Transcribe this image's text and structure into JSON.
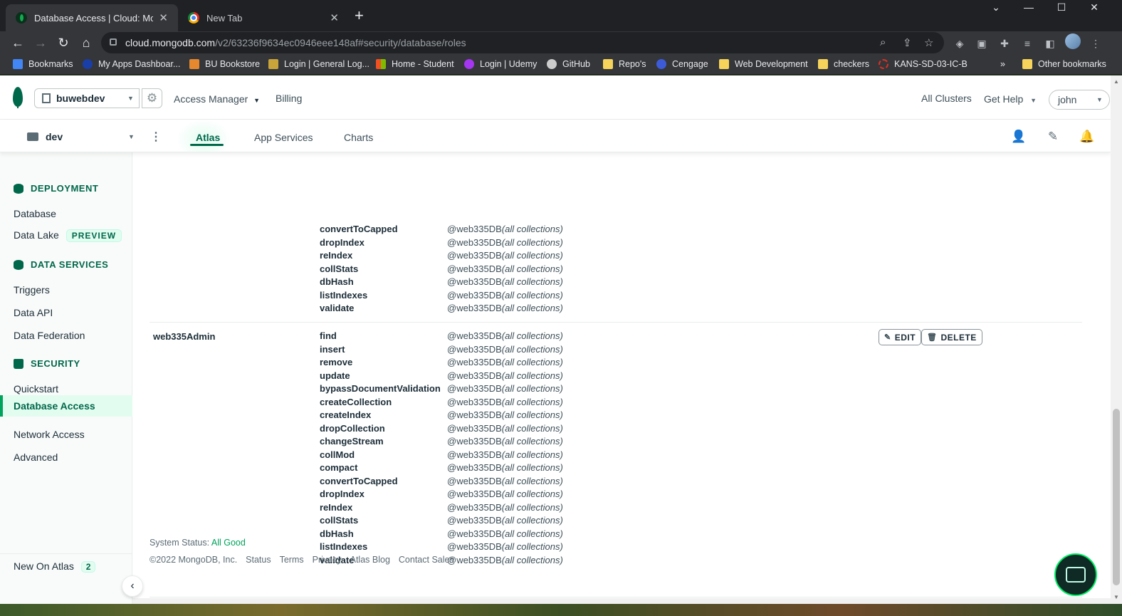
{
  "browser": {
    "tabs": [
      {
        "title": "Database Access | Cloud: Mongo",
        "active": true,
        "favicon": "mongodb-leaf-icon"
      },
      {
        "title": "New Tab",
        "active": false,
        "favicon": "chrome-icon"
      }
    ],
    "url_host": "cloud.mongodb.com",
    "url_path": "/v2/63236f9634ec0946eee148af#security/database/roles",
    "bookmarks": [
      {
        "label": "Bookmarks",
        "icon": "star-icon",
        "color": "#4285f4"
      },
      {
        "label": "My Apps Dashboar...",
        "icon": "globe-icon",
        "color": "#1a3ea8"
      },
      {
        "label": "BU Bookstore",
        "icon": "bookstore-icon",
        "color": "#e6892e"
      },
      {
        "label": "Login | General Log...",
        "icon": "eagle-icon",
        "color": "#c9a43a"
      },
      {
        "label": "Home - Student",
        "icon": "microsoft-icon",
        "color": "#f25022"
      },
      {
        "label": "Login | Udemy",
        "icon": "udemy-icon",
        "color": "#a435f0"
      },
      {
        "label": "GitHub",
        "icon": "github-icon",
        "color": "#cccccc"
      },
      {
        "label": "Repo's",
        "icon": "folder-icon",
        "color": "#f6d35b"
      },
      {
        "label": "Cengage",
        "icon": "cengage-icon",
        "color": "#3d5bd9"
      },
      {
        "label": "Web Development",
        "icon": "folder-icon",
        "color": "#f6d35b"
      },
      {
        "label": "checkers",
        "icon": "folder-icon",
        "color": "#f6d35b"
      },
      {
        "label": "KANS-SD-03-IC-B",
        "icon": "ring-icon",
        "color": "#d93025"
      }
    ],
    "overflow_label": "»",
    "other_bookmarks": "Other bookmarks"
  },
  "topnav": {
    "org": "buwebdev",
    "access_manager": "Access Manager",
    "billing": "Billing",
    "all_clusters": "All Clusters",
    "get_help": "Get Help",
    "user": "john"
  },
  "projnav": {
    "project": "dev",
    "tabs": [
      "Atlas",
      "App Services",
      "Charts"
    ],
    "active_tab": "Atlas"
  },
  "sidebar": {
    "deployment": {
      "heading": "DEPLOYMENT",
      "items": [
        "Database",
        "Data Lake"
      ],
      "data_lake_badge": "PREVIEW"
    },
    "data_services": {
      "heading": "DATA SERVICES",
      "items": [
        "Triggers",
        "Data API",
        "Data Federation"
      ]
    },
    "security": {
      "heading": "SECURITY",
      "items": [
        "Quickstart",
        "Database Access",
        "Network Access",
        "Advanced"
      ],
      "active": "Database Access"
    },
    "new_on_atlas": {
      "label": "New On Atlas",
      "count": "2"
    }
  },
  "roles": {
    "previous_tail": [
      {
        "action": "convertToCapped",
        "db": "@web335DB",
        "scope": "(all collections)"
      },
      {
        "action": "dropIndex",
        "db": "@web335DB",
        "scope": "(all collections)"
      },
      {
        "action": "reIndex",
        "db": "@web335DB",
        "scope": "(all collections)"
      },
      {
        "action": "collStats",
        "db": "@web335DB",
        "scope": "(all collections)"
      },
      {
        "action": "dbHash",
        "db": "@web335DB",
        "scope": "(all collections)"
      },
      {
        "action": "listIndexes",
        "db": "@web335DB",
        "scope": "(all collections)"
      },
      {
        "action": "validate",
        "db": "@web335DB",
        "scope": "(all collections)"
      }
    ],
    "web335Admin": {
      "name": "web335Admin",
      "edit_label": "EDIT",
      "delete_label": "DELETE",
      "actions": [
        {
          "action": "find",
          "db": "@web335DB",
          "scope": "(all collections)"
        },
        {
          "action": "insert",
          "db": "@web335DB",
          "scope": "(all collections)"
        },
        {
          "action": "remove",
          "db": "@web335DB",
          "scope": "(all collections)"
        },
        {
          "action": "update",
          "db": "@web335DB",
          "scope": "(all collections)"
        },
        {
          "action": "bypassDocumentValidation",
          "db": "@web335DB",
          "scope": "(all collections)"
        },
        {
          "action": "createCollection",
          "db": "@web335DB",
          "scope": "(all collections)"
        },
        {
          "action": "createIndex",
          "db": "@web335DB",
          "scope": "(all collections)"
        },
        {
          "action": "dropCollection",
          "db": "@web335DB",
          "scope": "(all collections)"
        },
        {
          "action": "changeStream",
          "db": "@web335DB",
          "scope": "(all collections)"
        },
        {
          "action": "collMod",
          "db": "@web335DB",
          "scope": "(all collections)"
        },
        {
          "action": "compact",
          "db": "@web335DB",
          "scope": "(all collections)"
        },
        {
          "action": "convertToCapped",
          "db": "@web335DB",
          "scope": "(all collections)"
        },
        {
          "action": "dropIndex",
          "db": "@web335DB",
          "scope": "(all collections)"
        },
        {
          "action": "reIndex",
          "db": "@web335DB",
          "scope": "(all collections)"
        },
        {
          "action": "collStats",
          "db": "@web335DB",
          "scope": "(all collections)"
        },
        {
          "action": "dbHash",
          "db": "@web335DB",
          "scope": "(all collections)"
        },
        {
          "action": "listIndexes",
          "db": "@web335DB",
          "scope": "(all collections)"
        },
        {
          "action": "validate",
          "db": "@web335DB",
          "scope": "(all collections)"
        }
      ]
    }
  },
  "footer": {
    "system_status_label": "System Status:",
    "system_status_value": "All Good",
    "copyright": "©2022 MongoDB, Inc.",
    "links": [
      "Status",
      "Terms",
      "Privacy",
      "Atlas Blog",
      "Contact Sales"
    ]
  },
  "colors": {
    "brand_green": "#00684a",
    "accent_green": "#00a35c",
    "active_bg": "#e3fcf0"
  }
}
